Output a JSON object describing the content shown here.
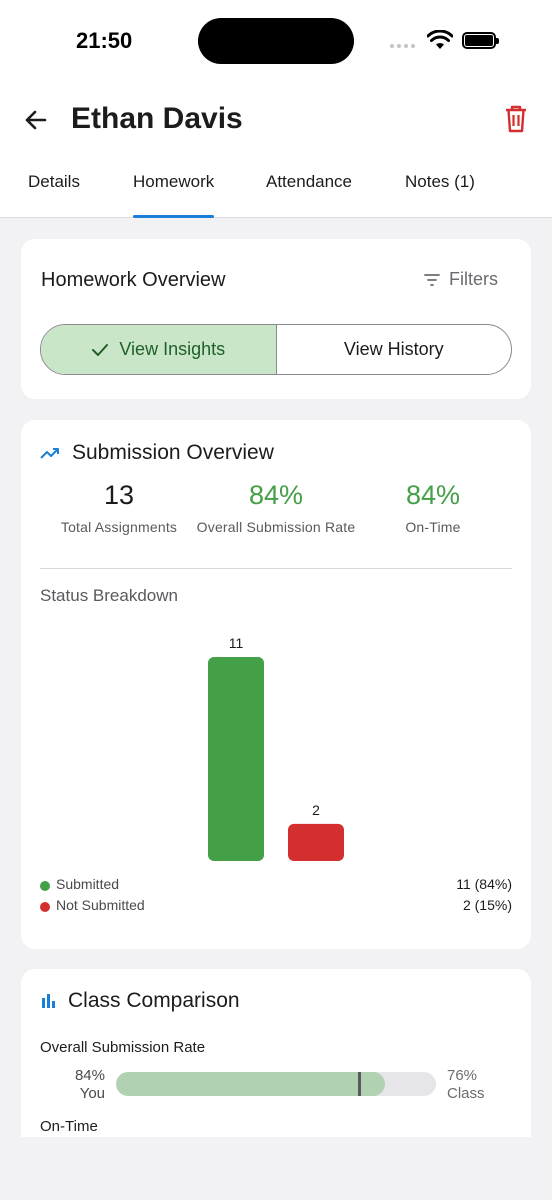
{
  "status_bar": {
    "time": "21:50"
  },
  "header": {
    "title": "Ethan Davis"
  },
  "tabs": [
    {
      "label": "Details"
    },
    {
      "label": "Homework",
      "active": true
    },
    {
      "label": "Attendance"
    },
    {
      "label": "Notes (1)"
    }
  ],
  "overview": {
    "title": "Homework Overview",
    "filters_label": "Filters",
    "segments": [
      {
        "label": "View Insights",
        "selected": true
      },
      {
        "label": "View History",
        "selected": false
      }
    ]
  },
  "submission": {
    "title": "Submission Overview",
    "stats": [
      {
        "value": "13",
        "label": "Total Assignments"
      },
      {
        "value": "84%",
        "label": "Overall Submission Rate"
      },
      {
        "value": "84%",
        "label": "On-Time"
      }
    ],
    "status_title": "Status Breakdown",
    "legend": [
      {
        "label": "Submitted",
        "value": "11 (84%)",
        "color": "#43a047"
      },
      {
        "label": "Not Submitted",
        "value": "2 (15%)",
        "color": "#d32f2f"
      }
    ]
  },
  "chart_data": {
    "type": "bar",
    "categories": [
      "Submitted",
      "Not Submitted"
    ],
    "values": [
      11,
      2
    ],
    "colors": [
      "#43a047",
      "#d32f2f"
    ],
    "data_labels": [
      "11",
      "2"
    ],
    "ylim": [
      0,
      11
    ]
  },
  "comparison": {
    "title": "Class Comparison",
    "metric_label": "Overall Submission Rate",
    "you_value": "84%",
    "you_label": "You",
    "class_value": "76%",
    "class_label": "Class",
    "you_fraction": 0.84,
    "class_fraction": 0.76,
    "next_metric_label": "On-Time"
  }
}
